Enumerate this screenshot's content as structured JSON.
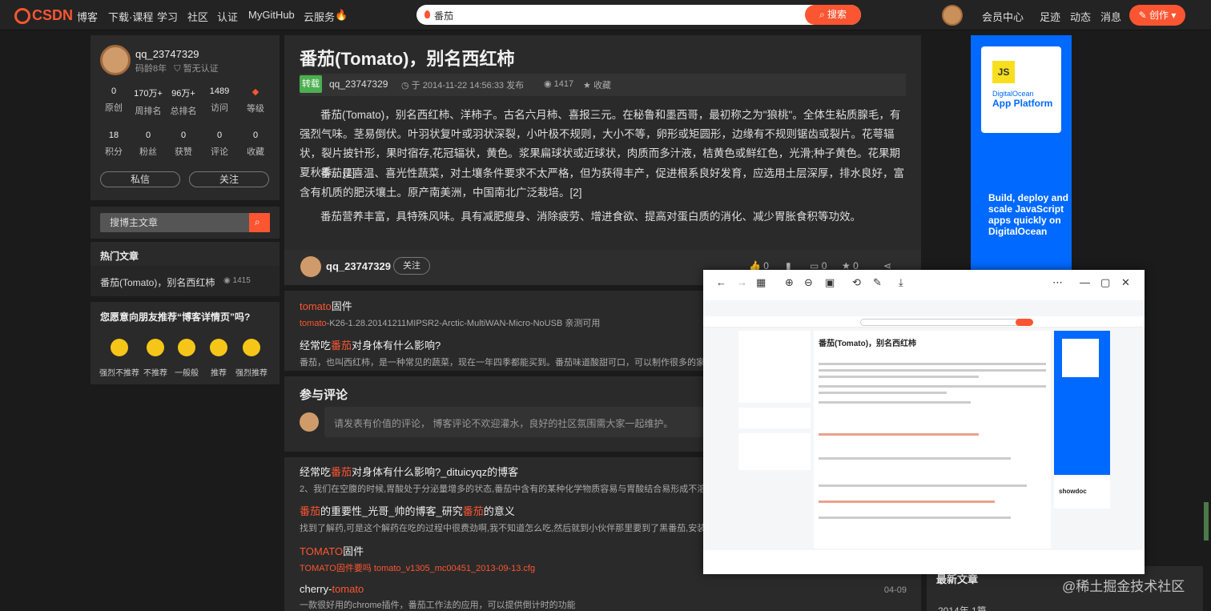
{
  "nav": {
    "logo": "CSDN",
    "items": [
      "博客",
      "下载·课程",
      "学习",
      "社区",
      "认证",
      "MyGitHub",
      "云服务"
    ],
    "search_value": "番茄",
    "search_button": "搜索",
    "right_items": [
      "会员中心",
      "足迹",
      "动态",
      "消息"
    ],
    "create_button": "创作"
  },
  "profile": {
    "name": "qq_23747329",
    "years": "码龄8年",
    "cert": "暂无认证",
    "stats_row1": [
      {
        "value": "0",
        "label": "原创"
      },
      {
        "value": "170万+",
        "label": "周排名"
      },
      {
        "value": "96万+",
        "label": "总排名"
      },
      {
        "value": "1489",
        "label": "访问"
      },
      {
        "value": "",
        "label": "等级"
      }
    ],
    "stats_row2": [
      {
        "value": "18",
        "label": "积分"
      },
      {
        "value": "0",
        "label": "粉丝"
      },
      {
        "value": "0",
        "label": "获赞"
      },
      {
        "value": "0",
        "label": "评论"
      },
      {
        "value": "0",
        "label": "收藏"
      }
    ],
    "message_button": "私信",
    "follow_button": "关注"
  },
  "side_search": {
    "placeholder": "搜博主文章"
  },
  "hot": {
    "header": "热门文章",
    "item": "番茄(Tomato)，别名西红柿",
    "views": "1415"
  },
  "recommend": {
    "header": "您愿意向朋友推荐“博客详情页”吗?",
    "options": [
      "强烈不推荐",
      "不推荐",
      "一般般",
      "推荐",
      "强烈推荐"
    ]
  },
  "article": {
    "title": "番茄(Tomato)，别名西红柿",
    "tag": "转载",
    "author": "qq_23747329",
    "date": "于 2014-11-22 14:56:33 发布",
    "views": "1417",
    "favorite": "收藏",
    "paragraphs": [
      "番茄(Tomato)，别名西红柿、洋柿子。古名六月柿、喜报三元。在秘鲁和墨西哥，最初称之为\"狼桃\"。全体生粘质腺毛，有强烈气味。茎易倒伏。叶羽状复叶或羽状深裂，小叶极不规则，大小不等，卵形或矩圆形，边缘有不规则锯齿或裂片。花萼辐状，裂片披针形，果时宿存,花冠辐状，黄色。浆果扁球状或近球状，肉质而多汁液，桔黄色或鲜红色，光滑;种子黄色。花果期夏秋季。[1]",
      "番茄是喜温、喜光性蔬菜，对土壤条件要求不太严格，但为获得丰产，促进根系良好发育，应选用土层深厚，排水良好，富含有机质的肥沃壤土。原产南美洲，中国南北广泛栽培。[2]",
      "番茄营养丰富，具特殊风味。具有减肥瘦身、消除疲劳、增进食欲、提高对蛋白质的消化、减少胃胀食积等功效。"
    ],
    "footer_author": "qq_23747329",
    "footer_follow": "关注",
    "counts": [
      "0",
      "0",
      "0"
    ]
  },
  "related": [
    {
      "t_hl": "tomato",
      "t_rest": "固件",
      "sub_hl": "tomato",
      "sub_rest": "-K26-1.28.20141211MIPSR2-Arctic-MultiWAN-Micro-NoUSB 亲测可用"
    },
    {
      "t_pre": "经常吃",
      "t_hl": "番茄",
      "t_rest": "对身体有什么影响?",
      "sub": "番茄，也叫西红柿，是一种常见的蔬菜，现在一年四季都能买到。番茄味道酸甜可口，可以制作很多的家"
    }
  ],
  "comment": {
    "header": "参与评论",
    "placeholder": "请发表有价值的评论， 博客评论不欢迎灌水，良好的社区氛围需大家一起维护。"
  },
  "related2": [
    {
      "t_pre": "经常吃",
      "t_hl": "番茄",
      "t_rest": "对身体有什么影响?_dituicyqz的博客",
      "sub": "2、我们在空腹的时候,胃酸处于分泌量增多的状态,番茄中含有的某种化学物质容易与胃酸结合易形成不溶"
    },
    {
      "t_hl": "番茄",
      "t_mid": "的重要性_光哥_帅的博客_研究",
      "t_hl2": "番茄",
      "t_rest": "的意义",
      "sub": "找到了解药,可是这个解药在吃的过程中很费劲啊,我不知道怎么吃,然后就到小伙伴那里要到了黑番茄,安装"
    },
    {
      "t_hl": "TOMATO",
      "t_rest": "固件",
      "sub": "TOMATO固件要吗 tomato_v1305_mc00451_2013-09-13.cfg"
    },
    {
      "t_pre": "cherry-",
      "t_hl": "tomato",
      "t_rest": "",
      "sub": "一款很好用的chrome插件，番茄工作法的应用，可以提供倒计时的功能",
      "date": "04-09"
    }
  ],
  "ad": {
    "brand": "DigitalOcean",
    "product": "App Platform",
    "tagline": "Build, deploy and scale JavaScript apps quickly on DigitalOcean",
    "color": "#0069ff"
  },
  "newest": {
    "header": "最新文章",
    "year": "2014年 1篇"
  },
  "viewer": {
    "mini_title": "番茄(Tomato)，别名西红柿",
    "mini_showdoc": "showdoc"
  },
  "watermark": "@稀土掘金技术社区",
  "colors": {
    "accent": "#fc5531",
    "bg": "#1b1b1b",
    "panel": "#2a2a2a"
  }
}
